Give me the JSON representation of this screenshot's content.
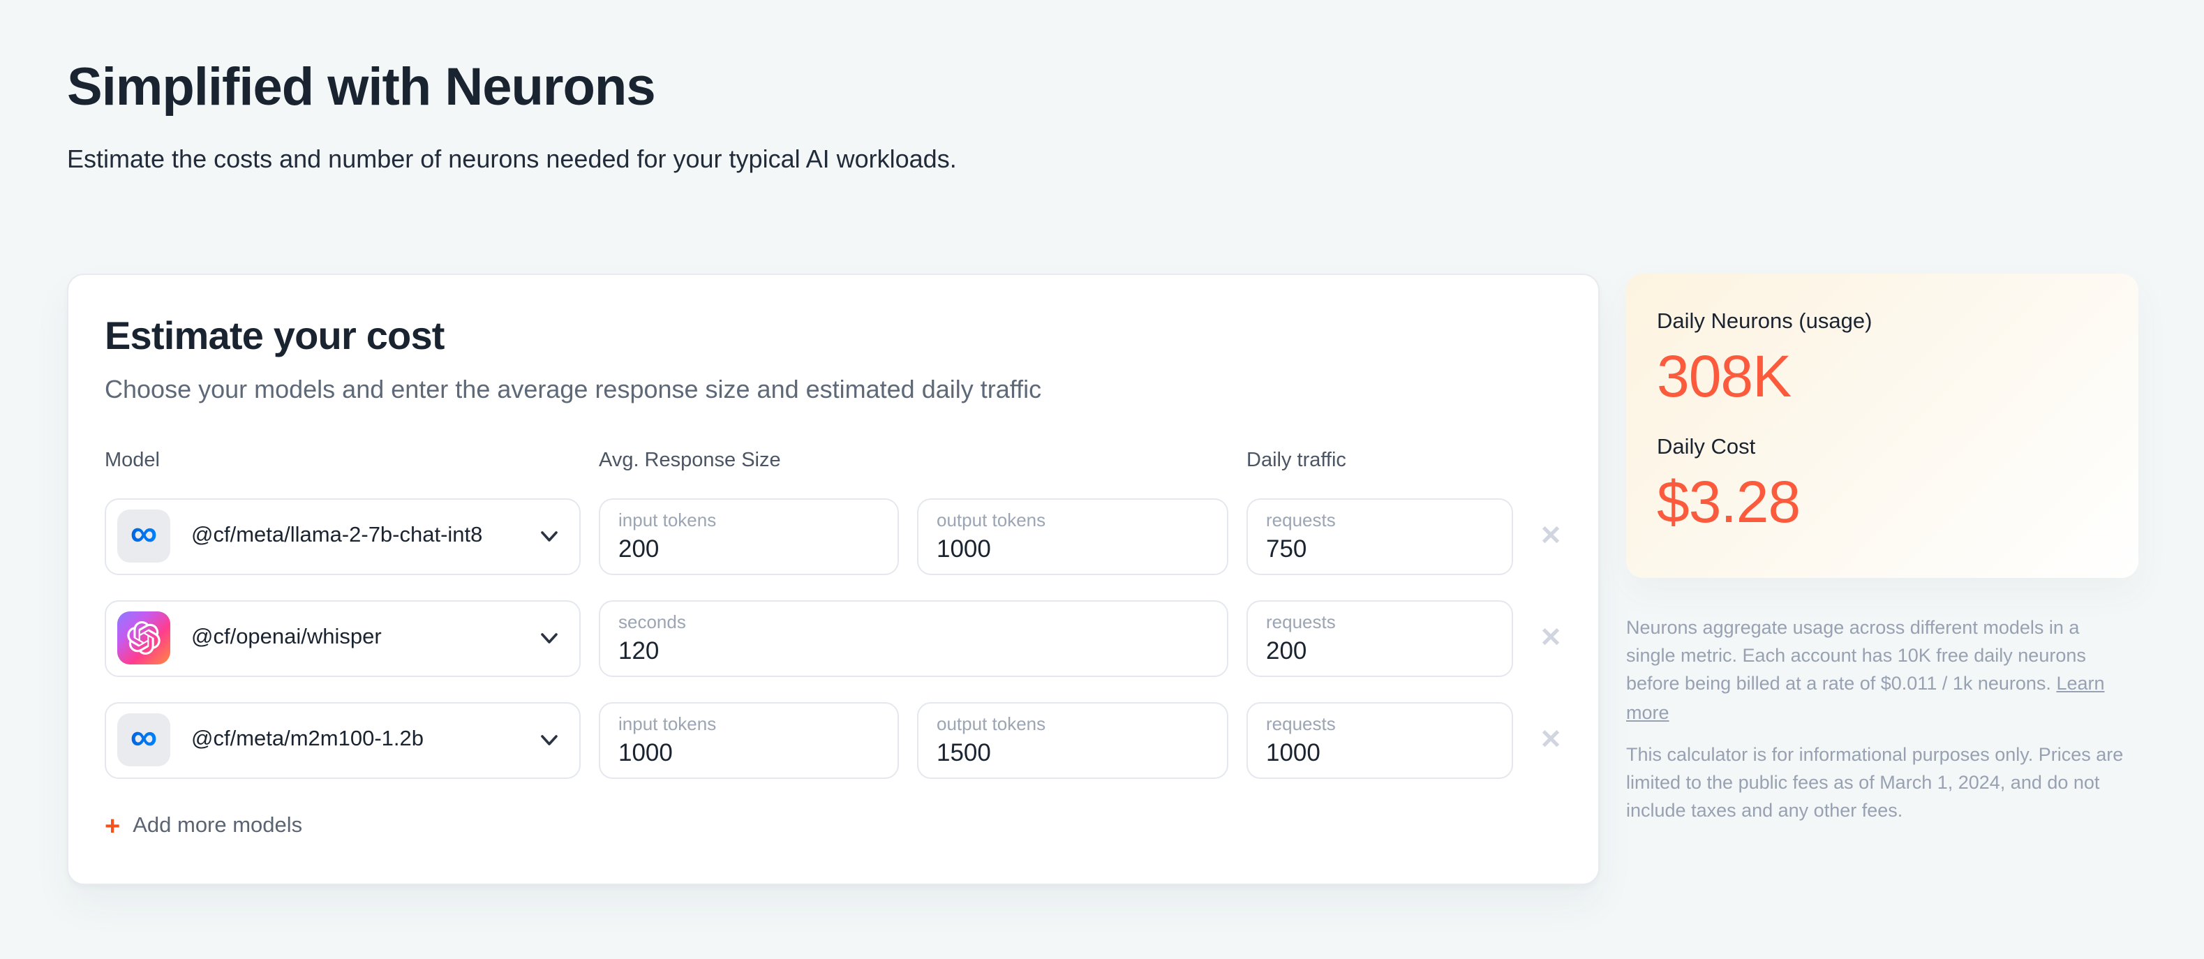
{
  "page": {
    "title": "Simplified with Neurons",
    "subtitle": "Estimate the costs and number of neurons needed for your typical AI workloads."
  },
  "calculator": {
    "title": "Estimate your cost",
    "subtitle": "Choose your models and enter the average response size and estimated daily traffic",
    "columns": {
      "model": "Model",
      "avg_response_size": "Avg. Response Size",
      "daily_traffic": "Daily traffic"
    },
    "rows": [
      {
        "model": "@cf/meta/llama-2-7b-chat-int8",
        "icon": "meta-icon",
        "field1": {
          "label": "input tokens",
          "value": "200"
        },
        "field2": {
          "label": "output tokens",
          "value": "1000"
        },
        "traffic": {
          "label": "requests",
          "value": "750"
        }
      },
      {
        "model": "@cf/openai/whisper",
        "icon": "openai-icon",
        "field1": {
          "label": "seconds",
          "value": "120"
        },
        "traffic": {
          "label": "requests",
          "value": "200"
        }
      },
      {
        "model": "@cf/meta/m2m100-1.2b",
        "icon": "meta-icon",
        "field1": {
          "label": "input tokens",
          "value": "1000"
        },
        "field2": {
          "label": "output tokens",
          "value": "1500"
        },
        "traffic": {
          "label": "requests",
          "value": "1000"
        }
      }
    ],
    "add_more_label": "Add more models"
  },
  "summary": {
    "neurons_label": "Daily Neurons (usage)",
    "neurons_value": "308K",
    "cost_label": "Daily Cost",
    "cost_value": "$3.28"
  },
  "footnotes": {
    "paragraph1": "Neurons aggregate usage across different models in a single metric. Each account has 10K free daily neurons before being billed at a rate of $0.011 / 1k neurons. ",
    "learn_more_label": "Learn more",
    "paragraph2": "This calculator is for informational purposes only. Prices are limited to the public fees as of March 1, 2024, and do not include taxes and any other fees."
  },
  "icons": {
    "meta_infinity": "∞",
    "close": "✕",
    "plus": "+",
    "chevron_down": "⌄"
  },
  "colors": {
    "accent_orange": "#FB5A3C",
    "plus_orange": "#F6511D",
    "meta_blue_start": "#0064E0",
    "meta_blue_end": "#0082FB",
    "summary_gradient_start": "#FDF3E0",
    "page_background": "#F3F7F8"
  }
}
